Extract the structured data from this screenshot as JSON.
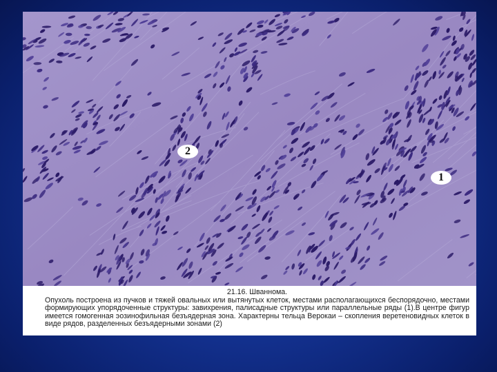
{
  "figure": {
    "markers": {
      "one": "1",
      "two": "2"
    },
    "caption": {
      "title": "21.16. Шваннома.",
      "body": "Опухоль построена из пучков и тяжей овальных или вытянутых клеток, местами располагающихся беспорядочно, местами формирующих упорядоченные структуры: завихрения, палисадные структуры или параллельные ряды (1).В центре фигур имеется гомогенная эозинофильная безъядерная зона. Характерны тельца Верокаи – скопления веретеновидных клеток в виде рядов, разделенных безъядерными зонами (2)"
    }
  },
  "colors": {
    "slide_background": "#13318f",
    "stroma": "#9a8ac4",
    "nuclei": "#2a1a66",
    "caption_background": "#ffffff"
  }
}
